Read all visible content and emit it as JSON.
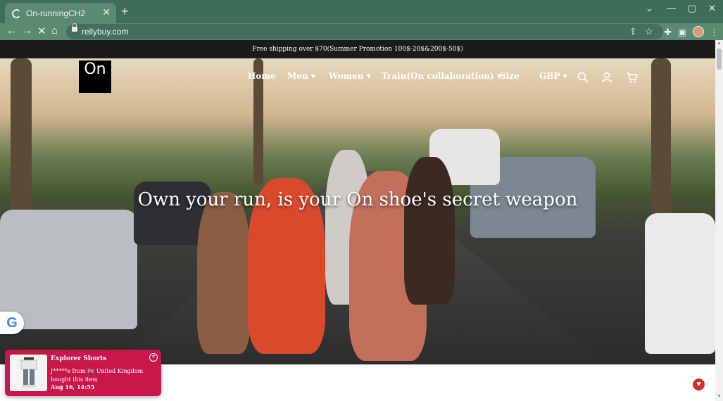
{
  "browser": {
    "tab_title": "On-runningCH2",
    "url": "rellybuy.com",
    "tab_close": "✕",
    "new_tab": "+",
    "window_controls": [
      "⌄",
      "—",
      "▢",
      "✕"
    ]
  },
  "site": {
    "announcement": "Free shipping over $70(Summer Promotion 100$-20$&200$-50$)",
    "logo_text": "On",
    "menu": {
      "home": "Home",
      "men": "Men",
      "women": "Women",
      "train": "Train(On collaboration)",
      "size": "Size",
      "currency": "GBP"
    },
    "hero_heading": "Own your run, is your On shoe's secret weapon"
  },
  "toast": {
    "product": "Explorer Shorts",
    "message": "J*****e from 🇬🇧 United Kingdom bought this item",
    "time": "Aug 16, 14:55"
  },
  "icons": [
    "loading-spinner-icon",
    "back-icon",
    "forward-icon",
    "stop-icon",
    "home-icon",
    "lock-icon",
    "share-icon",
    "star-icon",
    "extensions-icon",
    "sidepanel-icon",
    "menu-icon",
    "search-icon",
    "account-icon",
    "cart-icon",
    "google-icon",
    "help-icon",
    "close-icon"
  ],
  "colors": {
    "chrome_frame": "#3f6e58",
    "announcement_bg": "#1b1b1b",
    "toast_bg": "#c8174a"
  }
}
